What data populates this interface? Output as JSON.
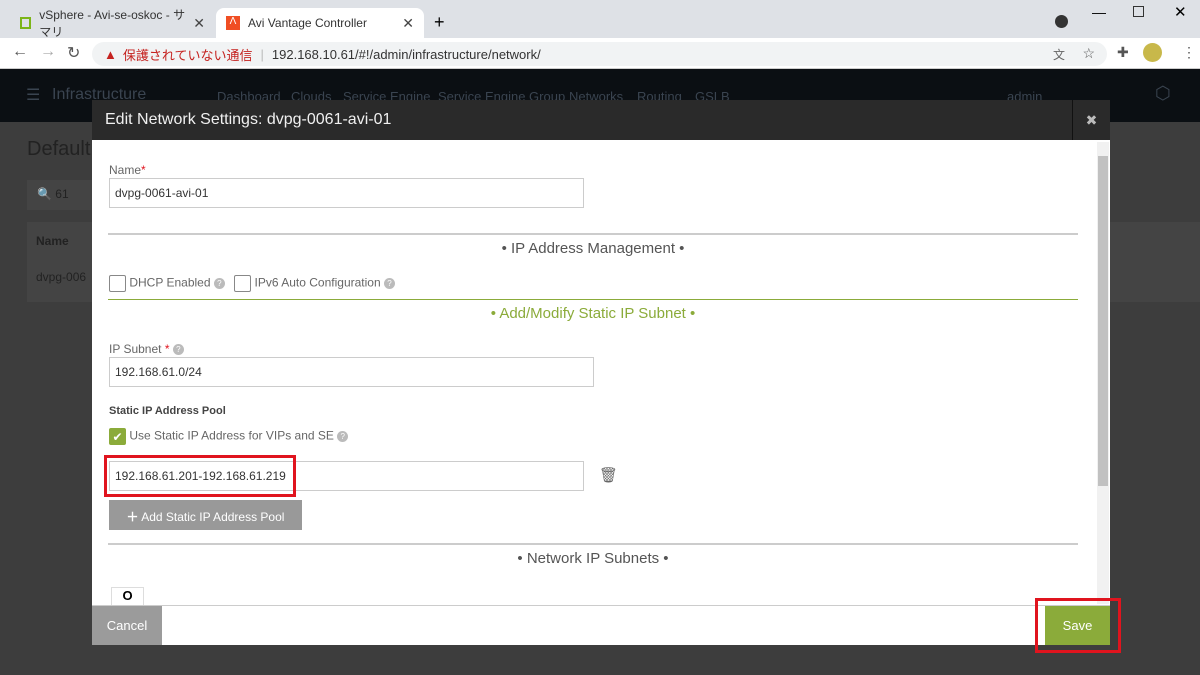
{
  "browser": {
    "tabs": [
      {
        "title": "vSphere - Avi-se-oskoc - サマリ",
        "icon": "vsphere-icon"
      },
      {
        "title": "Avi Vantage Controller",
        "icon": "avi-icon"
      }
    ],
    "security_warning": "保護されていない通信",
    "url": "192.168.10.61/#!/admin/infrastructure/network/"
  },
  "app": {
    "section": "Infrastructure",
    "nav": [
      "Dashboard",
      "Clouds",
      "Service Engine",
      "Service Engine Group",
      "Networks",
      "Routing",
      "GSLB"
    ],
    "user": "admin",
    "page_title": "Default",
    "search_value": "61",
    "table_header": "Name",
    "row_name": "dvpg-006"
  },
  "modal": {
    "title": "Edit Network Settings: dvpg-0061-avi-01",
    "name_label": "Name",
    "name_value": "dvpg-0061-avi-01",
    "ipam_section": "• IP Address Management •",
    "dhcp_label": "DHCP Enabled",
    "dhcp_checked": false,
    "ipv6_label": "IPv6 Auto Configuration",
    "ipv6_checked": false,
    "static_section": "• Add/Modify Static IP Subnet •",
    "subnet_label": "IP Subnet",
    "subnet_value": "192.168.61.0/24",
    "pool_heading": "Static IP Address Pool",
    "use_static_label": "Use Static IP Address for VIPs and SE",
    "use_static_checked": true,
    "pool_value": "192.168.61.201-192.168.61.219",
    "add_pool_label": "Add Static IP Address Pool",
    "subnets_section": "• Network IP Subnets •",
    "cancel": "Cancel",
    "save": "Save"
  },
  "colors": {
    "accent": "#8bab3a",
    "highlight": "#e0141e"
  }
}
